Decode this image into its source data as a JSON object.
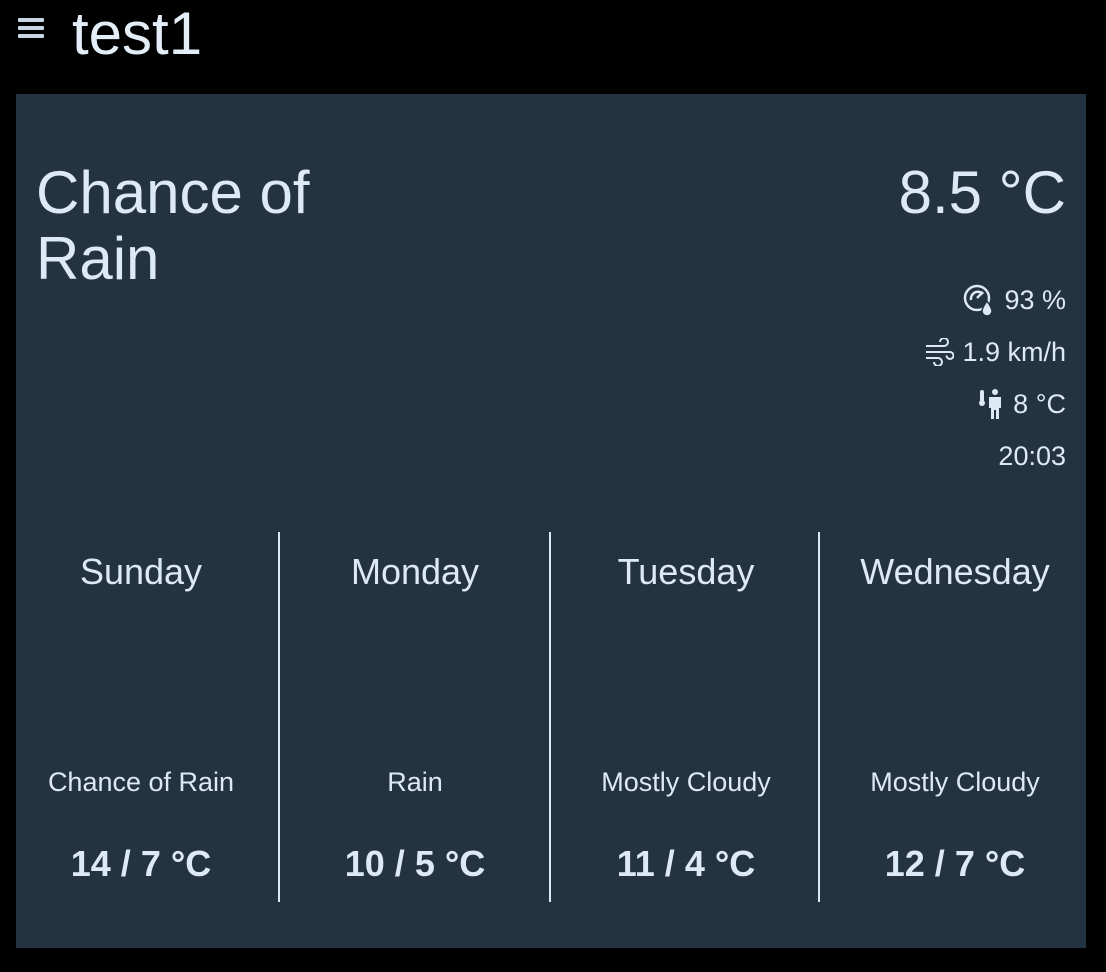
{
  "header": {
    "title": "test1"
  },
  "current": {
    "condition": "Chance of Rain",
    "temperature": "8.5 °C",
    "humidity": "93 %",
    "wind": "1.9 km/h",
    "feels_like": "8 °C",
    "time": "20:03"
  },
  "forecast": [
    {
      "day": "Sunday",
      "condition": "Chance of Rain",
      "temps": "14 / 7 °C"
    },
    {
      "day": "Monday",
      "condition": "Rain",
      "temps": "10 / 5 °C"
    },
    {
      "day": "Tuesday",
      "condition": "Mostly Cloudy",
      "temps": "11 / 4 °C"
    },
    {
      "day": "Wednesday",
      "condition": "Mostly Cloudy",
      "temps": "12 / 7 °C"
    }
  ],
  "icons": {
    "menu": "menu-icon",
    "humidity": "humidity-gauge-icon",
    "wind": "wind-icon",
    "feels_like": "thermometer-person-icon"
  },
  "colors": {
    "background": "#000000",
    "card": "#233342",
    "text": "#dde9f4"
  }
}
